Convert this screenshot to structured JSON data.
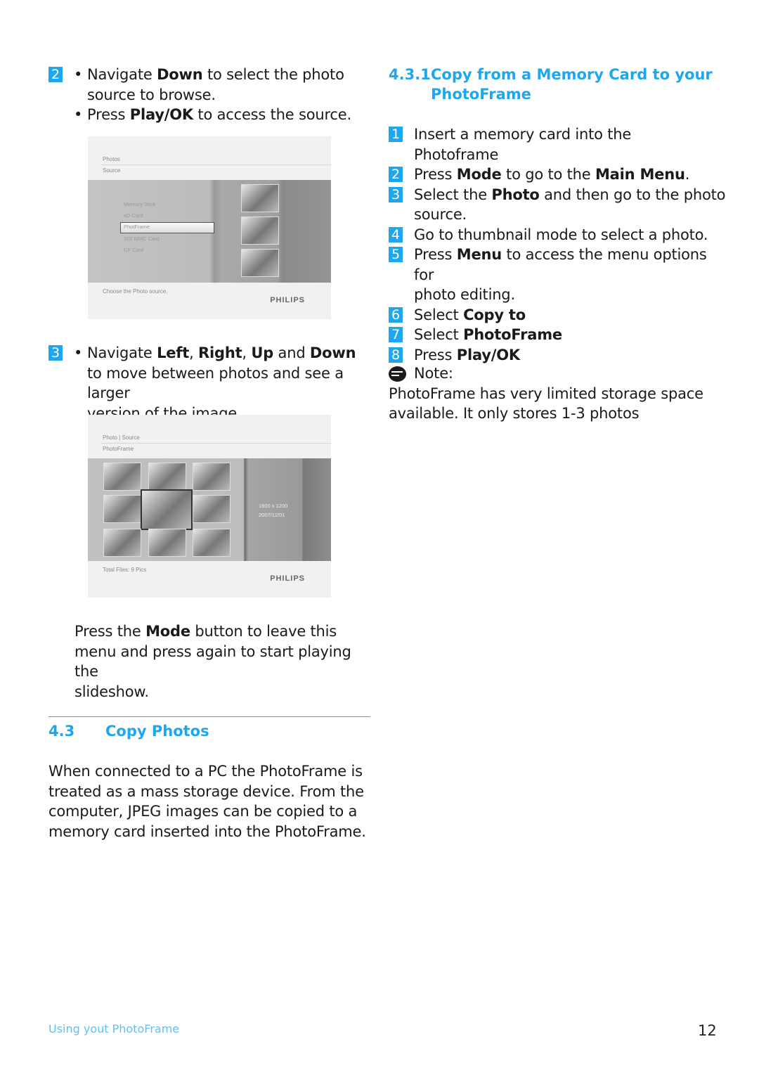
{
  "left": {
    "step2": {
      "badge": "2",
      "bullets": [
        {
          "pre": "Navigate ",
          "bold": "Down",
          "post": " to select the photo",
          "cont": "source to browse."
        },
        {
          "pre": "Press ",
          "bold": "Play/OK",
          "post": " to access the source.",
          "cont": ""
        }
      ]
    },
    "screenshot1": {
      "header_line1": "Photos",
      "header_line2": "Source",
      "menu_items": [
        "Memory Stick",
        "xD Card",
        "PhotFrame",
        "SD/ MMC Card",
        "CF Card"
      ],
      "selected_index": 2,
      "footer_text": "Choose the Photo source.",
      "logo": "PHILIPS"
    },
    "step3": {
      "badge": "3",
      "line1": {
        "pre": "Navigate ",
        "b1": "Left",
        "s1": ", ",
        "b2": "Right",
        "s2": ", ",
        "b3": "Up",
        "s3": " and ",
        "b4": "Down"
      },
      "line2": "to move between photos and see a larger",
      "line3": "version of the image."
    },
    "screenshot2": {
      "header_line1": "Photo | Source",
      "header_line2": "PhotoFrame",
      "resolution": "1600 x 1200",
      "date": "2007/12/01",
      "footer_text": "Total Files: 9 Pics",
      "logo": "PHILIPS"
    },
    "mode_para": {
      "pre": "Press the ",
      "bold": "Mode",
      "post": " button to leave this",
      "line2": "menu and press again to start playing the",
      "line3": "slideshow."
    },
    "section": {
      "number": "4.3",
      "title": "Copy Photos"
    },
    "section_para": [
      "When connected to a PC the PhotoFrame is",
      "treated as a mass storage device. From the",
      "computer, JPEG images can be copied to a",
      "memory card inserted into the PhotoFrame."
    ]
  },
  "right": {
    "subsection": {
      "number": "4.3.1",
      "title_line1": "Copy from a Memory Card to your",
      "title_line2": "PhotoFrame"
    },
    "steps": [
      {
        "badge": "1",
        "parts": [
          {
            "t": "Insert a memory card into the"
          }
        ],
        "cont": "Photoframe"
      },
      {
        "badge": "2",
        "parts": [
          {
            "t": "Press "
          },
          {
            "t": "Mode",
            "b": true
          },
          {
            "t": " to go to the "
          },
          {
            "t": "Main Menu",
            "b": true
          },
          {
            "t": "."
          }
        ],
        "cont": ""
      },
      {
        "badge": "3",
        "parts": [
          {
            "t": "Select the "
          },
          {
            "t": "Photo",
            "b": true
          },
          {
            "t": " and then go to the photo"
          }
        ],
        "cont": "source."
      },
      {
        "badge": "4",
        "parts": [
          {
            "t": "Go to thumbnail mode to select a photo."
          }
        ],
        "cont": ""
      },
      {
        "badge": "5",
        "parts": [
          {
            "t": "Press "
          },
          {
            "t": "Menu",
            "b": true
          },
          {
            "t": " to access the menu options for"
          }
        ],
        "cont": "photo editing."
      },
      {
        "badge": "6",
        "parts": [
          {
            "t": "Select "
          },
          {
            "t": "Copy to",
            "b": true
          }
        ],
        "cont": ""
      },
      {
        "badge": "7",
        "parts": [
          {
            "t": "Select "
          },
          {
            "t": "PhotoFrame",
            "b": true
          }
        ],
        "cont": ""
      },
      {
        "badge": "8",
        "parts": [
          {
            "t": "Press "
          },
          {
            "t": "Play/OK",
            "b": true
          }
        ],
        "cont": ""
      }
    ],
    "note": {
      "icon": "note-icon",
      "label": "Note:",
      "line1": "PhotoFrame has very limited storage space",
      "line2": "available. It only stores 1-3 photos"
    }
  },
  "footer": {
    "left": "Using yout PhotoFrame",
    "page_number": "12"
  },
  "colors": {
    "accent": "#1ea7ee",
    "footer_text": "#5bc2f5"
  }
}
